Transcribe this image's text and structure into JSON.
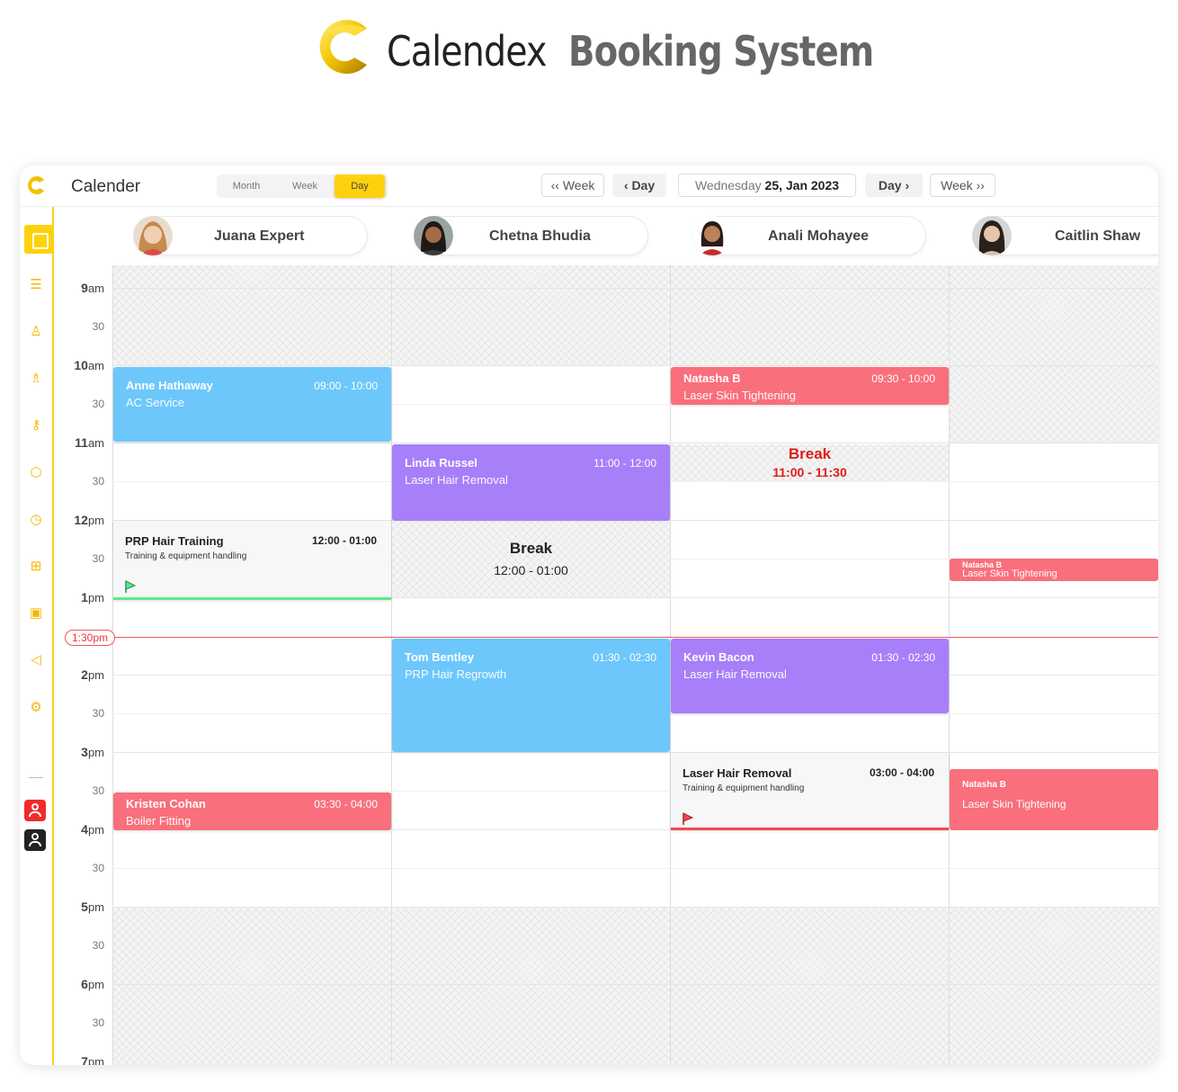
{
  "brand": {
    "name": "Calendex",
    "subtitle": "Booking System"
  },
  "app": {
    "title": "Calender",
    "views": {
      "month": "Month",
      "week": "Week",
      "day": "Day",
      "active": "Day"
    },
    "nav": {
      "prev_week": "Week",
      "prev_day": "Day",
      "next_day": "Day",
      "next_week": "Week"
    },
    "date": {
      "weekday": "Wednesday",
      "date": "25, Jan 2023"
    },
    "accent": "#fdd20c"
  },
  "sidebar": {
    "icons": [
      "calendar-icon",
      "list-icon",
      "user-icon",
      "staff-icon",
      "key-icon",
      "package-icon",
      "clock-icon",
      "gift-icon",
      "chart-icon",
      "megaphone-icon",
      "settings-icon",
      "profile-red-icon",
      "profile-dark-icon"
    ]
  },
  "staff": [
    {
      "name": "Juana Expert"
    },
    {
      "name": "Chetna Bhudia"
    },
    {
      "name": "Anali Mohayee"
    },
    {
      "name": "Caitlin Shaw"
    }
  ],
  "times": {
    "h9": "9",
    "h10": "10",
    "h11": "11",
    "h12": "12",
    "h1": "1",
    "h2": "2",
    "h3": "3",
    "h4": "4",
    "h5": "5",
    "h6": "6",
    "h7": "7",
    "am": "am",
    "pm": "pm",
    "half": "30",
    "now": "1:30pm"
  },
  "events": {
    "anne": {
      "name": "Anne Hathaway",
      "time": "09:00 - 10:00",
      "service": "AC Service"
    },
    "prp_training": {
      "name": "PRP Hair Training",
      "time": "12:00 - 01:00",
      "desc": "Training & equipment handling"
    },
    "kristen": {
      "name": "Kristen Cohan",
      "time": "03:30 - 04:00",
      "service": "Boiler Fitting"
    },
    "linda": {
      "name": "Linda Russel",
      "time": "11:00 - 12:00",
      "service": "Laser Hair Removal"
    },
    "break_chetna": {
      "title": "Break",
      "time": "12:00 - 01:00"
    },
    "tom": {
      "name": "Tom Bentley",
      "time": "01:30 - 02:30",
      "service": "PRP Hair Regrowth"
    },
    "natasha_anali": {
      "name": "Natasha B",
      "time": "09:30 - 10:00",
      "service": "Laser Skin Tightening"
    },
    "break_anali": {
      "title": "Break",
      "time": "11:00 - 11:30"
    },
    "kevin": {
      "name": "Kevin Bacon",
      "time": "01:30 - 02:30",
      "service": "Laser Hair Removal"
    },
    "laser_training": {
      "name": "Laser Hair Removal",
      "time": "03:00 - 04:00",
      "desc": "Training & equipment handling"
    },
    "natasha_c1": {
      "name": "Natasha B",
      "service": "Laser Skin Tightening"
    },
    "natasha_c2": {
      "name": "Natasha B",
      "service": "Laser Skin Tightening"
    }
  }
}
